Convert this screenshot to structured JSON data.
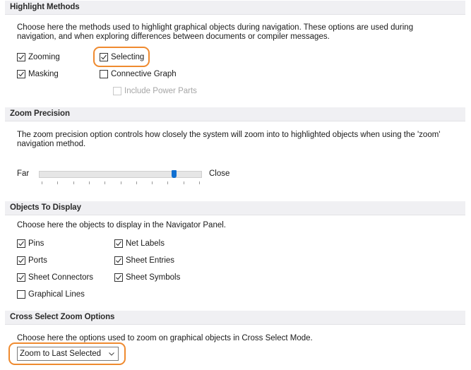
{
  "sections": {
    "highlight_methods": {
      "title": "Highlight Methods",
      "description_line1": "Choose here the methods used to highlight graphical objects during navigation. These options are used during",
      "description_line2": "navigation, and when exploring differences between documents or compiler messages.",
      "options": [
        {
          "label": "Zooming",
          "checked": true,
          "enabled": true
        },
        {
          "label": "Selecting",
          "checked": true,
          "enabled": true,
          "highlighted": true
        },
        {
          "label": "Masking",
          "checked": true,
          "enabled": true
        },
        {
          "label": "Connective Graph",
          "checked": false,
          "enabled": true
        },
        {
          "label": "Include Power Parts",
          "checked": false,
          "enabled": false
        }
      ]
    },
    "zoom_precision": {
      "title": "Zoom Precision",
      "description_line1": "The zoom precision option controls how closely the system will zoom into to highlighted objects when using the 'zoom'",
      "description_line2": "navigation method.",
      "slider": {
        "min_label": "Far",
        "max_label": "Close",
        "tick_count": 11,
        "value_fraction": 0.84
      }
    },
    "objects_to_display": {
      "title": "Objects To Display",
      "description": "Choose here the objects to display in the Navigator Panel.",
      "options": [
        {
          "label": "Pins",
          "checked": true
        },
        {
          "label": "Net Labels",
          "checked": true
        },
        {
          "label": "Ports",
          "checked": true
        },
        {
          "label": "Sheet Entries",
          "checked": true
        },
        {
          "label": "Sheet Connectors",
          "checked": true
        },
        {
          "label": "Sheet Symbols",
          "checked": true
        },
        {
          "label": "Graphical Lines",
          "checked": false
        }
      ]
    },
    "cross_select": {
      "title": "Cross Select Zoom Options",
      "description": "Choose here the options used to zoom on graphical objects in Cross Select Mode.",
      "dropdown": {
        "selected": "Zoom to Last Selected",
        "highlighted": true
      }
    }
  },
  "colors": {
    "highlight_ring": "#ef8a2f",
    "slider_thumb": "#0f6fd1",
    "section_header_bg": "#f0f0f3"
  }
}
